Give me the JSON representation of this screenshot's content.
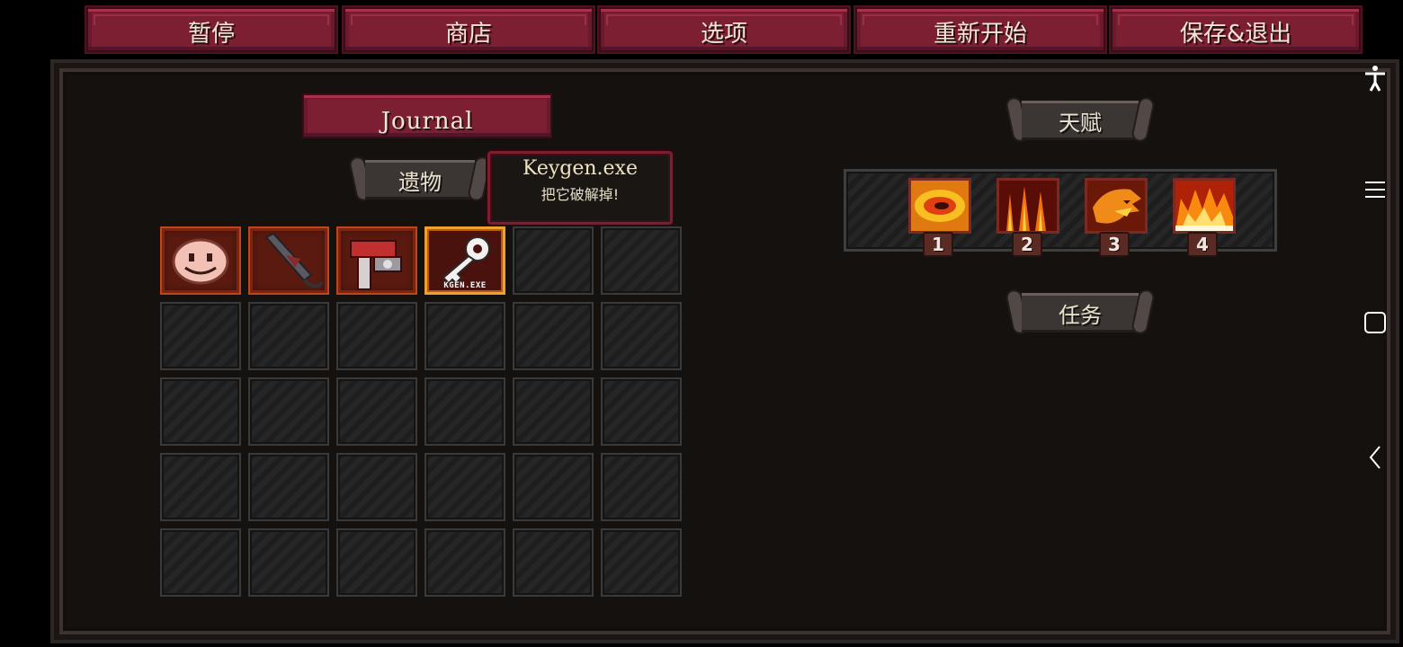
{
  "top_menu": {
    "pause": "暂停",
    "shop": "商店",
    "options": "选项",
    "restart": "重新开始",
    "save_exit": "保存&退出"
  },
  "journal": {
    "label": "Journal"
  },
  "relics": {
    "header": "遗物",
    "items": [
      {
        "name": "smiley-face-relic-icon"
      },
      {
        "name": "dark-dagger-relic-icon"
      },
      {
        "name": "red-machine-relic-icon"
      },
      {
        "name": "keygen-key-relic-icon",
        "caption": "KGEN.EXE",
        "selected": true
      }
    ]
  },
  "tooltip": {
    "title": "Keygen.exe",
    "description": "把它破解掉!"
  },
  "talents": {
    "header": "天赋",
    "items": [
      {
        "icon": "fire-vortex-icon",
        "number": "1"
      },
      {
        "icon": "fire-rain-icon",
        "number": "2"
      },
      {
        "icon": "fire-dragon-icon",
        "number": "3"
      },
      {
        "icon": "fire-wall-icon",
        "number": "4"
      }
    ]
  },
  "quests": {
    "header": "任务"
  },
  "colors": {
    "button": "#7c1f33",
    "panel": "#15110f",
    "relic_border": "#c2441a",
    "selected_border": "#f0a030"
  }
}
